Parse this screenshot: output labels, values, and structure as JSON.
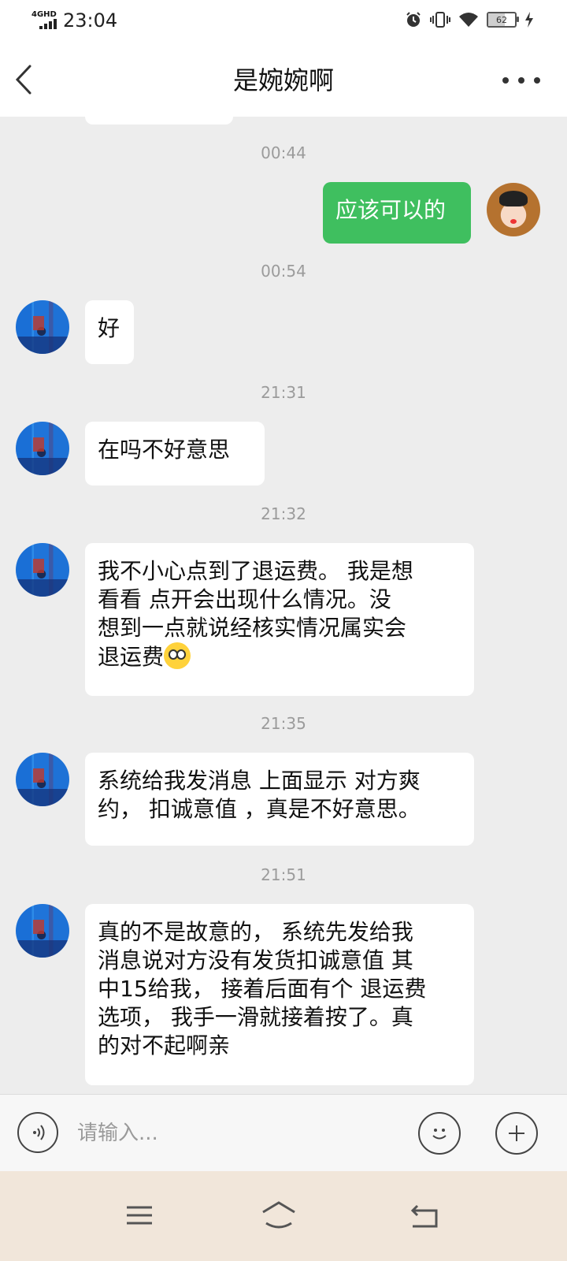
{
  "status_bar": {
    "network": "4GHD",
    "time": "23:04",
    "battery": "62"
  },
  "header": {
    "title": "是婉婉啊"
  },
  "chat": {
    "items": [
      {
        "timestamp": "00:44",
        "sender": "self",
        "text": "应该可以的"
      },
      {
        "timestamp": "00:54",
        "sender": "other",
        "text": "好"
      },
      {
        "timestamp": "21:31",
        "sender": "other",
        "text": "在吗不好意思"
      },
      {
        "timestamp": "21:32",
        "sender": "other",
        "lines": [
          "我不小心点到了退运费。 我是想",
          "看看  点开会出现什么情况。没",
          "想到一点就说经核实情况属实会",
          "退运费"
        ]
      },
      {
        "timestamp": "21:35",
        "sender": "other",
        "lines": [
          "系统给我发消息 上面显示 对方爽",
          "约， 扣诚意值 ，真是不好意思。"
        ]
      },
      {
        "timestamp": "21:51",
        "sender": "other",
        "lines": [
          "真的不是故意的， 系统先发给我",
          "消息说对方没有发货扣诚意值 其",
          "中15给我， 接着后面有个 退运费",
          "选项， 我手一滑就接着按了。真",
          "的对不起啊亲"
        ]
      }
    ]
  },
  "input": {
    "placeholder": "请输入..."
  },
  "icons": {
    "back": "chevron-left-icon",
    "more": "more-dots-icon",
    "voice": "voice-icon",
    "emoji": "emoji-icon",
    "add": "plus-icon",
    "menu": "menu-icon",
    "home": "home-icon",
    "back_nav": "back-nav-icon"
  },
  "colors": {
    "self_bubble": "#3fbf5f",
    "chat_bg": "#ededed",
    "nav_bg": "#f1e6da"
  }
}
